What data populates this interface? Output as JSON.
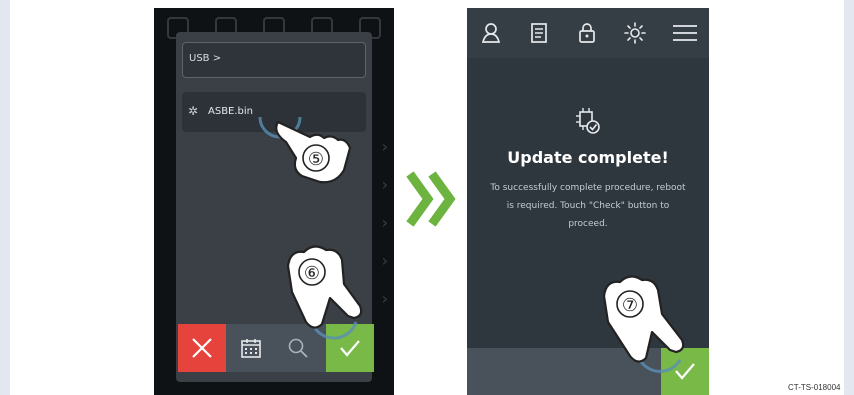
{
  "left_screen": {
    "usb_path": "USB >",
    "file_name": "ASBE.bin",
    "buttons": {
      "cancel": "cancel",
      "calendar": "calendar",
      "search": "search",
      "confirm": "confirm"
    }
  },
  "right_screen": {
    "title": "Update complete!",
    "message": "To successfully complete procedure, reboot is required. Touch \"Check\" button to proceed.",
    "top_icons": [
      "user-icon",
      "document-icon",
      "lock-icon",
      "brightness-icon",
      "menu-icon"
    ]
  },
  "steps": {
    "step5": "⑤",
    "step6": "⑥",
    "step7": "⑦"
  },
  "document_code": "CT-TS-018004",
  "colors": {
    "cancel_red": "#e5433b",
    "confirm_green": "#78b947",
    "arrow_green": "#6cb33f",
    "panel_dark": "#353d45"
  }
}
